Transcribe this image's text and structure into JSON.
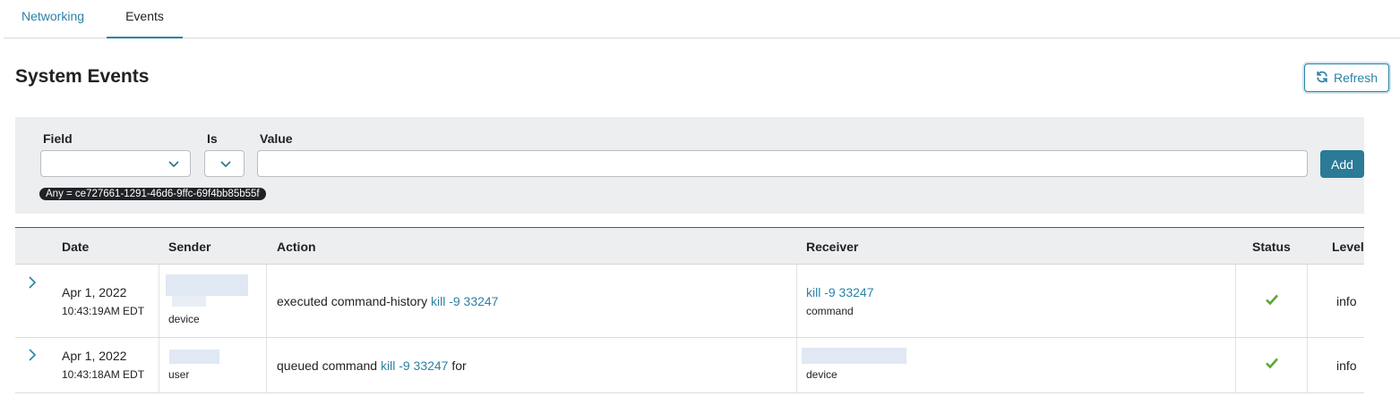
{
  "tabs": [
    {
      "label": "Networking"
    },
    {
      "label": "Events"
    }
  ],
  "page": {
    "title": "System Events",
    "refresh_label": "Refresh"
  },
  "filter": {
    "field_label": "Field",
    "is_label": "Is",
    "value_label": "Value",
    "value_placeholder": "",
    "add_label": "Add",
    "chip": "Any = ce727661-1291-46d6-9ffc-69f4bb85b55f"
  },
  "table": {
    "headers": [
      "Date",
      "Sender",
      "Action",
      "Receiver",
      "Status",
      "Level"
    ],
    "rows": [
      {
        "date": "Apr 1, 2022",
        "time": "10:43:19AM EDT",
        "sender_type": "device",
        "action_text": "executed command-history",
        "action_link": "kill -9 33247",
        "action_suffix": "",
        "receiver_link": "kill -9 33247",
        "receiver_type": "command",
        "status": "success",
        "level": "info"
      },
      {
        "date": "Apr 1, 2022",
        "time": "10:43:18AM EDT",
        "sender_type": "user",
        "action_text": "queued command",
        "action_link": "kill -9 33247",
        "action_suffix": "for",
        "receiver_link": "",
        "receiver_type": "device",
        "status": "success",
        "level": "info"
      }
    ]
  },
  "colors": {
    "accent": "#2b82a5",
    "add_button": "#2b7a96",
    "success": "#5aa832"
  }
}
